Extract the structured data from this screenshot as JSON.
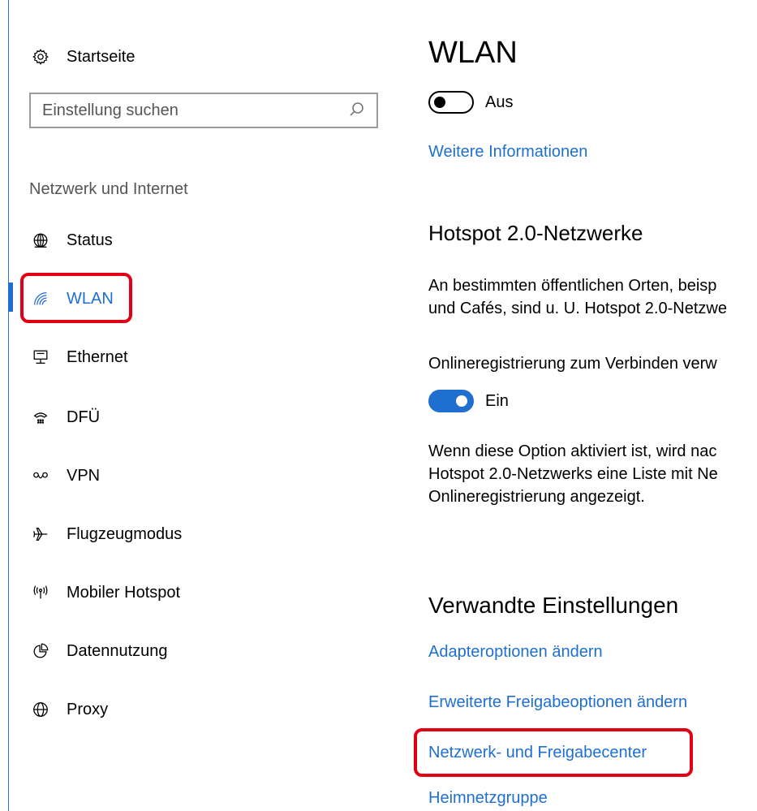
{
  "colors": {
    "accent": "#1f6fd1",
    "highlight_box": "#e10014",
    "left_border": "#2b79d6"
  },
  "sidebar": {
    "home": {
      "label": "Startseite",
      "icon": "gear-icon"
    },
    "search": {
      "placeholder": "Einstellung suchen",
      "icon": "search-icon"
    },
    "section_title": "Netzwerk und Internet",
    "items": [
      {
        "label": "Status",
        "icon": "globe-status-icon",
        "active": false
      },
      {
        "label": "WLAN",
        "icon": "wifi-icon",
        "active": true
      },
      {
        "label": "Ethernet",
        "icon": "ethernet-icon",
        "active": false
      },
      {
        "label": "DFÜ",
        "icon": "dialup-icon",
        "active": false
      },
      {
        "label": "VPN",
        "icon": "vpn-icon",
        "active": false
      },
      {
        "label": "Flugzeugmodus",
        "icon": "airplane-icon",
        "active": false
      },
      {
        "label": "Mobiler Hotspot",
        "icon": "hotspot-icon",
        "active": false
      },
      {
        "label": "Datennutzung",
        "icon": "pie-chart-icon",
        "active": false
      },
      {
        "label": "Proxy",
        "icon": "globe-icon",
        "active": false
      }
    ]
  },
  "main": {
    "title": "WLAN",
    "wifi_toggle": {
      "state": "off",
      "label": "Aus"
    },
    "more_info_link": "Weitere Informationen",
    "hotspot": {
      "heading": "Hotspot 2.0-Netzwerke",
      "description_line1": "An bestimmten öffentlichen Orten, beisp",
      "description_line2": "und Cafés, sind u. U. Hotspot 2.0-Netzwe",
      "online_registration_label": "Onlineregistrierung zum Verbinden verw",
      "online_toggle": {
        "state": "on",
        "label": "Ein"
      },
      "note_line1": "Wenn diese Option aktiviert ist, wird nac",
      "note_line2": "Hotspot 2.0-Netzwerks eine Liste mit Ne",
      "note_line3": "Onlineregistrierung angezeigt."
    },
    "related": {
      "heading": "Verwandte Einstellungen",
      "links": [
        "Adapteroptionen ändern",
        "Erweiterte Freigabeoptionen ändern",
        "Netzwerk- und Freigabecenter",
        "Heimnetzgruppe"
      ]
    }
  }
}
